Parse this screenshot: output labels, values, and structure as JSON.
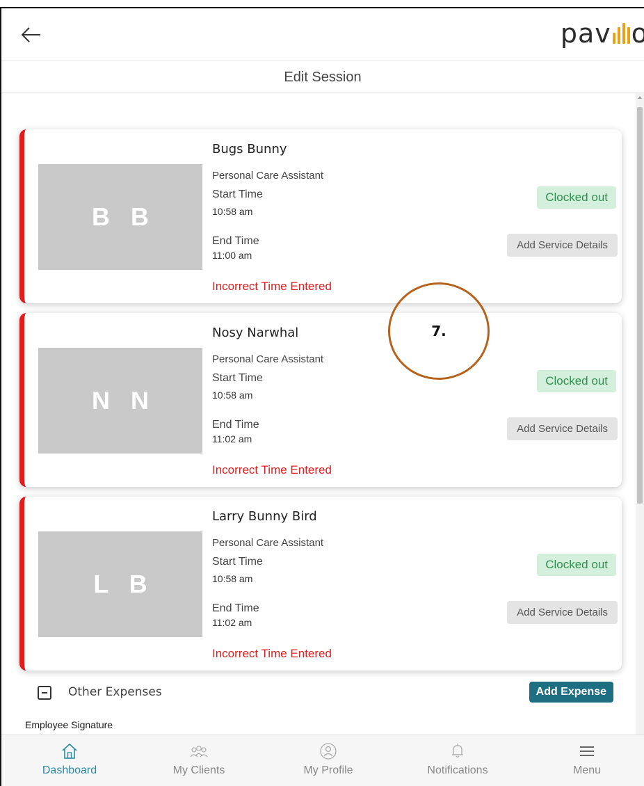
{
  "header": {
    "logo_text_left": "pav",
    "logo_text_right": "o",
    "brand_color": "#e7a11b",
    "title": "Edit Session"
  },
  "sessions": [
    {
      "initials": "B B",
      "name": "Bugs Bunny",
      "role": "Personal Care Assistant",
      "start_label": "Start Time",
      "start_time": "10:58 am",
      "end_label": "End Time",
      "end_time": "11:00 am",
      "error": "Incorrect Time Entered",
      "status": "Clocked out",
      "action": "Add Service Details"
    },
    {
      "initials": "N N",
      "name": "Nosy Narwhal",
      "role": "Personal Care Assistant",
      "start_label": "Start Time",
      "start_time": "10:58 am",
      "end_label": "End Time",
      "end_time": "11:02 am",
      "error": "Incorrect Time Entered",
      "status": "Clocked out",
      "action": "Add Service Details"
    },
    {
      "initials": "L B",
      "name": "Larry Bunny Bird",
      "role": "Personal Care Assistant",
      "start_label": "Start Time",
      "start_time": "10:58 am",
      "end_label": "End Time",
      "end_time": "11:02 am",
      "error": "Incorrect Time Entered",
      "status": "Clocked out",
      "action": "Add Service Details"
    }
  ],
  "annotation": {
    "label": "7."
  },
  "expenses": {
    "label": "Other Expenses",
    "add_label": "Add Expense"
  },
  "signature": {
    "label": "Employee Signature"
  },
  "bottom_nav": [
    {
      "label": "Dashboard",
      "icon": "home-icon",
      "active": true
    },
    {
      "label": "My Clients",
      "icon": "clients-icon",
      "active": false
    },
    {
      "label": "My Profile",
      "icon": "profile-icon",
      "active": false
    },
    {
      "label": "Notifications",
      "icon": "bell-icon",
      "active": false
    },
    {
      "label": "Menu",
      "icon": "hamburger-icon",
      "active": false
    }
  ],
  "colors": {
    "error_red": "#e21c1c",
    "status_green_bg": "#d4f0dd",
    "status_green_text": "#2f8f4e",
    "add_expense_bg": "#1f6f83",
    "active_nav": "#2a8aa3"
  }
}
